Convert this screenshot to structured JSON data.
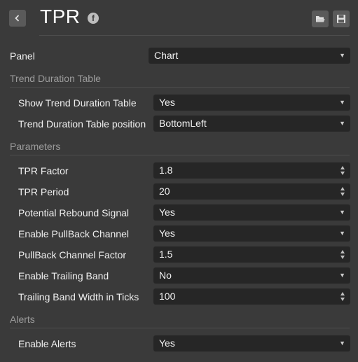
{
  "header": {
    "title": "TPR",
    "facebook_glyph": "f"
  },
  "panel_row": {
    "label": "Panel",
    "value": "Chart"
  },
  "sections": {
    "trend_duration_table": "Trend Duration Table",
    "parameters": "Parameters",
    "alerts": "Alerts"
  },
  "trend_table": {
    "show_label": "Show Trend Duration Table",
    "show_value": "Yes",
    "position_label": "Trend Duration Table position",
    "position_value": "BottomLeft"
  },
  "params": {
    "tpr_factor_label": "TPR Factor",
    "tpr_factor_value": "1.8",
    "tpr_period_label": "TPR Period",
    "tpr_period_value": "20",
    "rebound_label": "Potential Rebound Signal",
    "rebound_value": "Yes",
    "pullback_enable_label": "Enable PullBack Channel",
    "pullback_enable_value": "Yes",
    "pullback_factor_label": "PullBack Channel Factor",
    "pullback_factor_value": "1.5",
    "trailing_enable_label": "Enable Trailing Band",
    "trailing_enable_value": "No",
    "trailing_width_label": "Trailing Band Width in Ticks",
    "trailing_width_value": "100"
  },
  "alerts": {
    "enable_label": "Enable Alerts",
    "enable_value": "Yes"
  },
  "glyphs": {
    "caret": "▼"
  },
  "colors": {
    "background": "#3a3a3a",
    "field_background": "#262626",
    "button_background": "#5a5a5a",
    "section_text": "#9b9b9b"
  }
}
